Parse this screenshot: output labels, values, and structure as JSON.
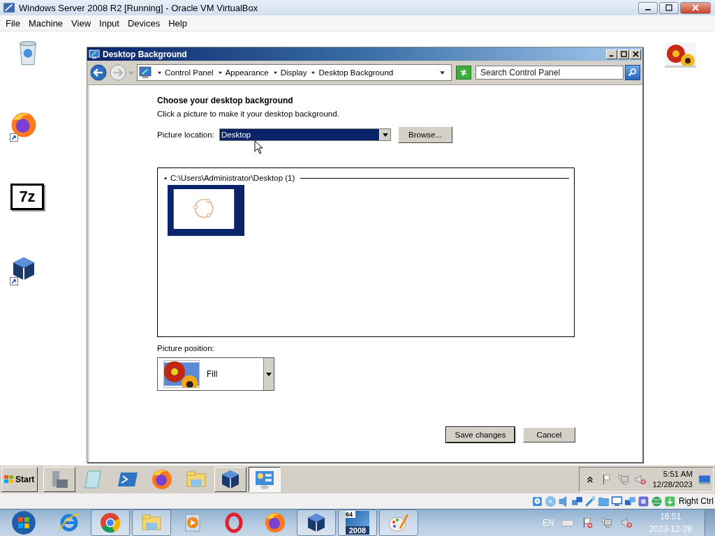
{
  "host": {
    "title": "Windows Server 2008 R2 [Running] - Oracle VM VirtualBox",
    "menu": [
      "File",
      "Machine",
      "View",
      "Input",
      "Devices",
      "Help"
    ]
  },
  "desktop": {
    "icons": [
      {
        "kind": "recycle-bin",
        "shortcut": false
      },
      {
        "kind": "firefox",
        "shortcut": true
      },
      {
        "kind": "sevenzip",
        "shortcut": false,
        "label": "7z"
      },
      {
        "kind": "virtualbox",
        "shortcut": true
      },
      {
        "kind": "picture",
        "shortcut": false
      }
    ]
  },
  "dialog": {
    "title": "Desktop Background",
    "breadcrumb": [
      "Control Panel",
      "Appearance",
      "Display",
      "Desktop Background"
    ],
    "search": {
      "placeholder": "Search Control Panel"
    },
    "heading": "Choose your desktop background",
    "subtitle": "Click a picture to make it your desktop background.",
    "location_label": "Picture location:",
    "location_value": "Desktop",
    "browse": "Browse...",
    "group": {
      "label": "C:\\Users\\Administrator\\Desktop (1)",
      "expanded": true,
      "pictures": [
        {
          "selected": true
        }
      ]
    },
    "position_label": "Picture position:",
    "position_value": "Fill",
    "buttons": [
      {
        "label": "Save changes",
        "default": true
      },
      {
        "label": "Cancel",
        "default": false
      }
    ]
  },
  "guest_taskbar": {
    "start": "Start",
    "items": [
      {
        "kind": "server-manager",
        "running": true,
        "selected": false
      },
      {
        "kind": "notepad",
        "running": false,
        "selected": false
      },
      {
        "kind": "powershell",
        "running": false,
        "selected": false
      },
      {
        "kind": "firefox",
        "running": false,
        "selected": false
      },
      {
        "kind": "explorer",
        "running": false,
        "selected": false
      },
      {
        "kind": "virtualbox",
        "running": true,
        "selected": false
      },
      {
        "kind": "control-panel",
        "running": true,
        "selected": true
      }
    ],
    "tray": [
      {
        "kind": "chevron"
      },
      {
        "kind": "flag"
      },
      {
        "kind": "network"
      },
      {
        "kind": "volume-muted"
      }
    ],
    "time": "5:51 AM",
    "date": "12/28/2023",
    "end_icon": {
      "kind": "monitor"
    }
  },
  "status_bar": {
    "icons": [
      {
        "kind": "hdd"
      },
      {
        "kind": "cd"
      },
      {
        "kind": "audio"
      },
      {
        "kind": "net2"
      },
      {
        "kind": "usb"
      },
      {
        "kind": "folder"
      },
      {
        "kind": "display"
      },
      {
        "kind": "screens"
      },
      {
        "kind": "chip"
      },
      {
        "kind": "globe"
      },
      {
        "kind": "download"
      }
    ],
    "key": "Right Ctrl"
  },
  "host_taskbar": {
    "items": [
      {
        "kind": "start-orb",
        "running": false
      },
      {
        "kind": "ie",
        "running": false
      },
      {
        "kind": "chrome",
        "running": true
      },
      {
        "kind": "explorer",
        "running": true
      },
      {
        "kind": "media",
        "running": false
      },
      {
        "kind": "opera",
        "running": false
      },
      {
        "kind": "firefox",
        "running": false
      },
      {
        "kind": "virtualbox",
        "running": true
      },
      {
        "kind": "server-2008",
        "running": true,
        "badge": "64",
        "caption": "2008"
      },
      {
        "kind": "paint",
        "running": true
      }
    ],
    "language": "EN",
    "tray": [
      {
        "kind": "keyboard"
      },
      {
        "kind": "flag-x"
      },
      {
        "kind": "network"
      },
      {
        "kind": "volume-muted"
      }
    ],
    "time": "16:51",
    "date": "2023-12-28"
  }
}
